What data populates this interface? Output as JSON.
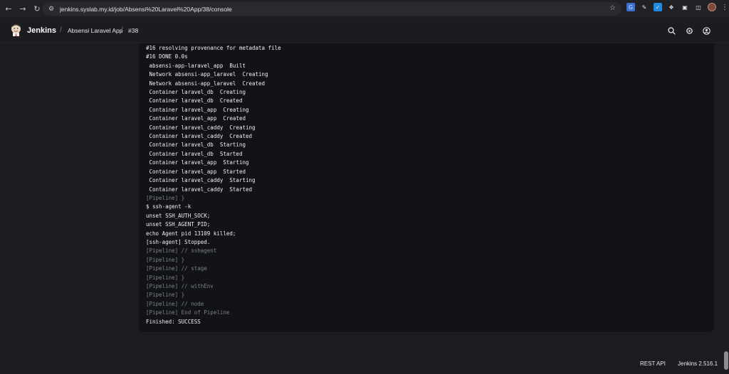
{
  "browser": {
    "url": "jenkins.syslab.my.id/job/Absensi%20Laravel%20App/38/console"
  },
  "header": {
    "brand": "Jenkins",
    "breadcrumbs": [
      "Absensi Laravel App",
      "#38"
    ]
  },
  "console": {
    "lines": [
      {
        "text": "#16 resolving provenance for metadata file",
        "kind": "out"
      },
      {
        "text": "#16 DONE 0.0s",
        "kind": "out"
      },
      {
        "text": " absensi-app-laravel_app  Built",
        "kind": "out"
      },
      {
        "text": " Network absensi-app_laravel  Creating",
        "kind": "out"
      },
      {
        "text": " Network absensi-app_laravel  Created",
        "kind": "out"
      },
      {
        "text": " Container laravel_db  Creating",
        "kind": "out"
      },
      {
        "text": " Container laravel_db  Created",
        "kind": "out"
      },
      {
        "text": " Container laravel_app  Creating",
        "kind": "out"
      },
      {
        "text": " Container laravel_app  Created",
        "kind": "out"
      },
      {
        "text": " Container laravel_caddy  Creating",
        "kind": "out"
      },
      {
        "text": " Container laravel_caddy  Created",
        "kind": "out"
      },
      {
        "text": " Container laravel_db  Starting",
        "kind": "out"
      },
      {
        "text": " Container laravel_db  Started",
        "kind": "out"
      },
      {
        "text": " Container laravel_app  Starting",
        "kind": "out"
      },
      {
        "text": " Container laravel_app  Started",
        "kind": "out"
      },
      {
        "text": " Container laravel_caddy  Starting",
        "kind": "out"
      },
      {
        "text": " Container laravel_caddy  Started",
        "kind": "out"
      },
      {
        "text": "[Pipeline] }",
        "kind": "pipe"
      },
      {
        "text": "$ ssh-agent -k",
        "kind": "out"
      },
      {
        "text": "unset SSH_AUTH_SOCK;",
        "kind": "out"
      },
      {
        "text": "unset SSH_AGENT_PID;",
        "kind": "out"
      },
      {
        "text": "echo Agent pid 13109 killed;",
        "kind": "out"
      },
      {
        "text": "[ssh-agent] Stopped.",
        "kind": "out"
      },
      {
        "text": "[Pipeline] // sshagent",
        "kind": "pipe"
      },
      {
        "text": "[Pipeline] }",
        "kind": "pipe"
      },
      {
        "text": "[Pipeline] // stage",
        "kind": "pipe"
      },
      {
        "text": "[Pipeline] }",
        "kind": "pipe"
      },
      {
        "text": "[Pipeline] // withEnv",
        "kind": "pipe"
      },
      {
        "text": "[Pipeline] }",
        "kind": "pipe"
      },
      {
        "text": "[Pipeline] // node",
        "kind": "pipe"
      },
      {
        "text": "[Pipeline] End of Pipeline",
        "kind": "pipe"
      },
      {
        "text": "Finished: SUCCESS",
        "kind": "out"
      }
    ]
  },
  "footer": {
    "rest_api": "REST API",
    "version": "Jenkins 2.516.1"
  },
  "colors": {
    "page_bg": "#1c1d22",
    "console_bg": "#121317",
    "console_text": "#f0f0f0",
    "pipeline_text": "#7c808b"
  }
}
